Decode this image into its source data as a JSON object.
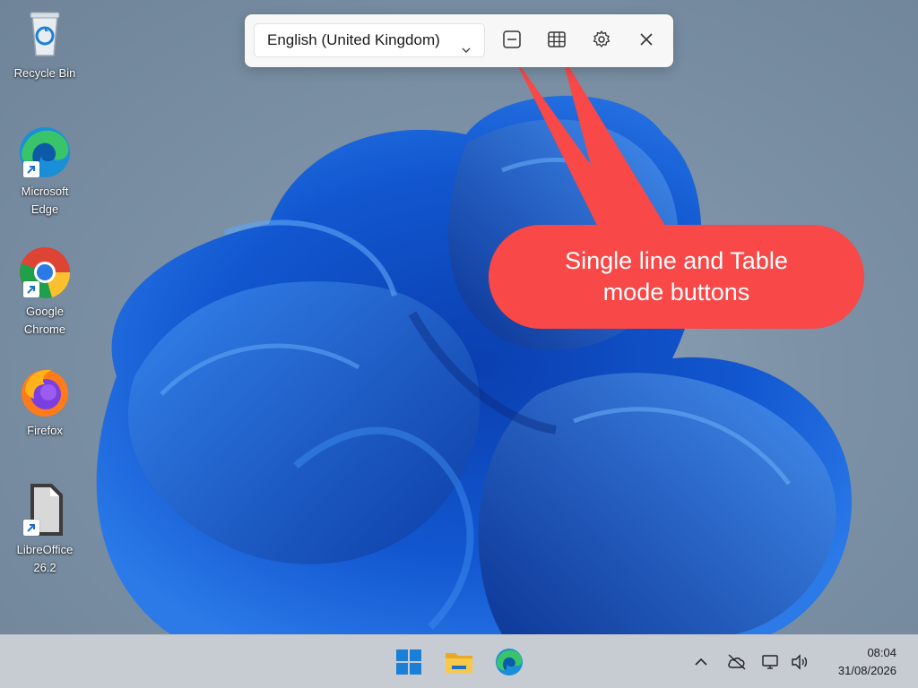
{
  "desktop_icons": [
    {
      "label": "Recycle Bin",
      "icon": "recycle-bin-icon"
    },
    {
      "label": "Microsoft Edge",
      "icon": "edge-icon"
    },
    {
      "label": "Google Chrome",
      "icon": "chrome-icon"
    },
    {
      "label": "Firefox",
      "icon": "firefox-icon"
    },
    {
      "label": "LibreOffice 26.2",
      "icon": "libreoffice-icon"
    }
  ],
  "toolbar": {
    "language": "English (United Kingdom)",
    "buttons": [
      {
        "icon": "single-line-icon"
      },
      {
        "icon": "table-icon"
      },
      {
        "icon": "gear-icon"
      },
      {
        "icon": "close-icon"
      }
    ]
  },
  "annotation": {
    "line1": "Single line and Table",
    "line2": "mode buttons",
    "color": "#f84848"
  },
  "taskbar": {
    "apps": [
      "windows-start-icon",
      "file-explorer-icon",
      "edge-icon"
    ],
    "tray": [
      "chevron-up-icon",
      "cloud-off-icon",
      "network-icon",
      "volume-icon"
    ],
    "time": "08:04",
    "date": "31/08/2026"
  }
}
